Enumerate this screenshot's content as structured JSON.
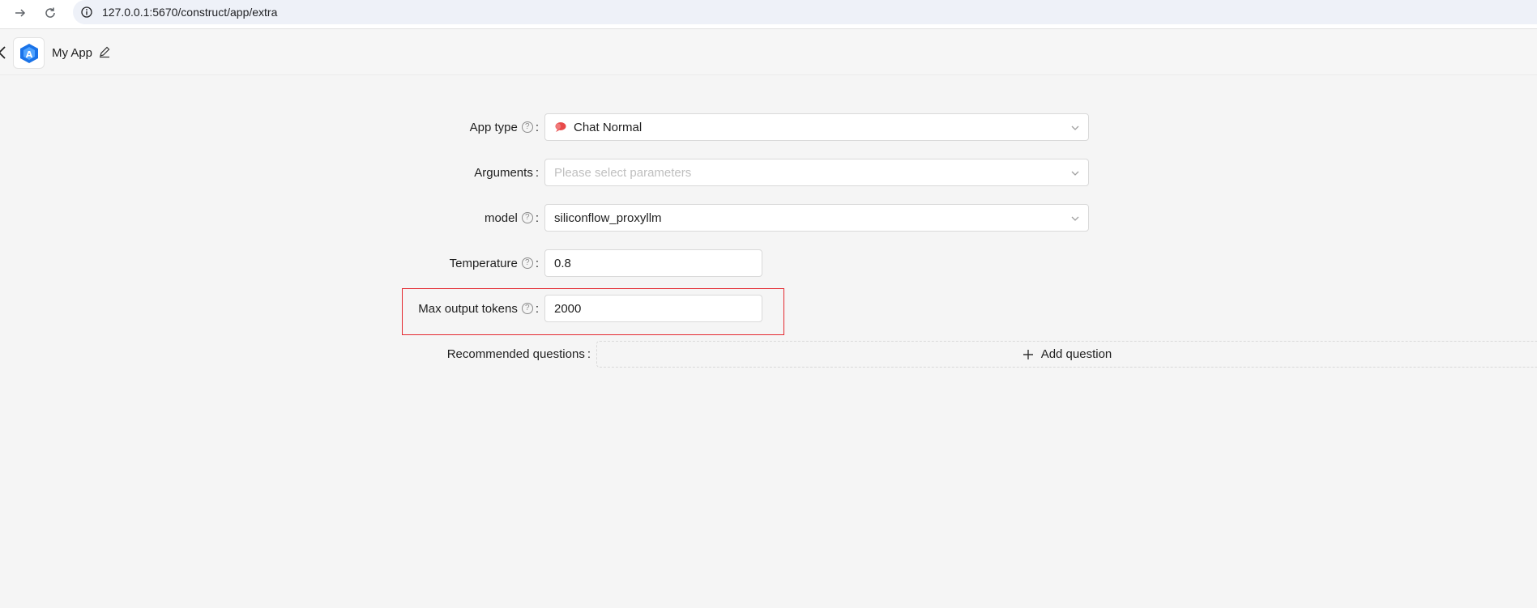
{
  "browser": {
    "url": "127.0.0.1:5670/construct/app/extra"
  },
  "header": {
    "app_name": "My App"
  },
  "form": {
    "app_type": {
      "label": "App type",
      "value": "Chat Normal",
      "icon": "chat-normal-icon"
    },
    "arguments": {
      "label": "Arguments",
      "placeholder": "Please select parameters"
    },
    "model": {
      "label": "model",
      "value": "siliconflow_proxyllm"
    },
    "temperature": {
      "label": "Temperature",
      "value": "0.8"
    },
    "max_tokens": {
      "label": "Max output tokens",
      "value": "2000"
    },
    "recommended": {
      "label": "Recommended questions",
      "add_label": "Add question"
    },
    "colon": ":"
  },
  "colors": {
    "highlight": "#e4282f",
    "logo_blue": "#1a73e8",
    "background": "#f5f5f5"
  }
}
